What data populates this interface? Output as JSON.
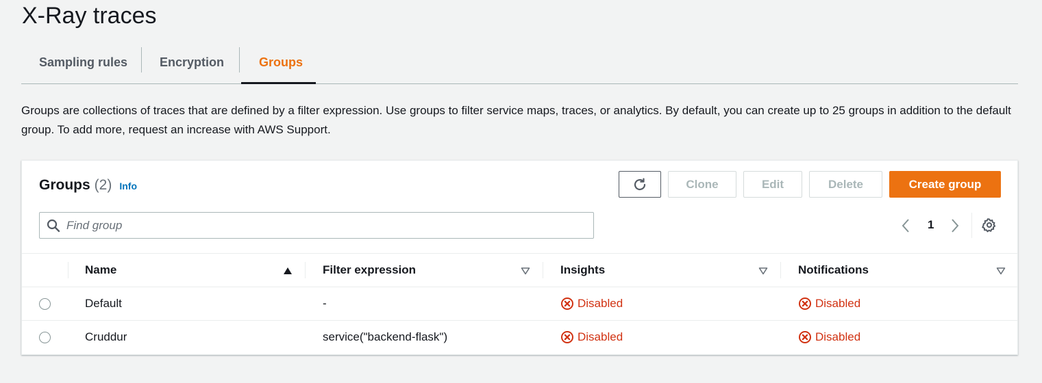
{
  "page": {
    "title": "X-Ray traces"
  },
  "tabs": [
    {
      "label": "Sampling rules",
      "active": false
    },
    {
      "label": "Encryption",
      "active": false
    },
    {
      "label": "Groups",
      "active": true
    }
  ],
  "description": "Groups are collections of traces that are defined by a filter expression. Use groups to filter service maps, traces, or analytics. By default, you can create up to 25 groups in addition to the default group. To add more, request an increase with AWS Support.",
  "panel": {
    "title": "Groups",
    "count": "(2)",
    "info_link": "Info",
    "buttons": {
      "refresh_icon": "refresh-icon",
      "clone": "Clone",
      "edit": "Edit",
      "delete": "Delete",
      "create": "Create group"
    },
    "search": {
      "placeholder": "Find group",
      "value": ""
    },
    "pagination": {
      "current_page": "1"
    }
  },
  "table": {
    "columns": [
      {
        "label": "Name",
        "sort": "ascending"
      },
      {
        "label": "Filter expression",
        "sort": "none"
      },
      {
        "label": "Insights",
        "sort": "none"
      },
      {
        "label": "Notifications",
        "sort": "none"
      }
    ],
    "rows": [
      {
        "name": "Default",
        "filter_expression": "-",
        "insights": "Disabled",
        "notifications": "Disabled"
      },
      {
        "name": "Cruddur",
        "filter_expression": "service(\"backend-flask\")",
        "insights": "Disabled",
        "notifications": "Disabled"
      }
    ]
  },
  "colors": {
    "accent": "#ec7211",
    "link": "#0073bb",
    "error": "#d13212",
    "background": "#f2f3f3"
  }
}
